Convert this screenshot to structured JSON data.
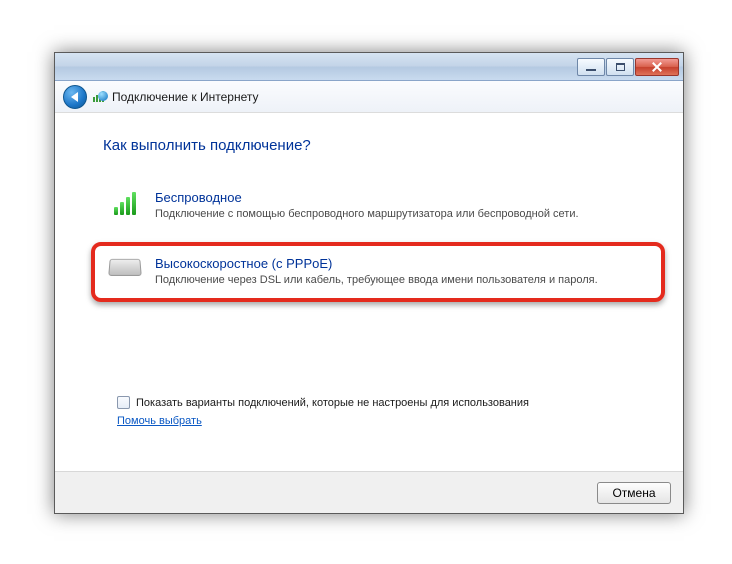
{
  "window": {
    "title": "Подключение к Интернету"
  },
  "heading": "Как выполнить подключение?",
  "options": {
    "wireless": {
      "title": "Беспроводное",
      "desc": "Подключение с помощью беспроводного маршрутизатора или беспроводной сети."
    },
    "pppoe": {
      "title": "Высокоскоростное (с PPPoE)",
      "desc": "Подключение через DSL или кабель, требующее ввода имени пользователя и пароля."
    }
  },
  "show_checkbox_label": "Показать варианты подключений, которые не настроены для использования",
  "help_link": "Помочь выбрать",
  "buttons": {
    "cancel": "Отмена"
  }
}
